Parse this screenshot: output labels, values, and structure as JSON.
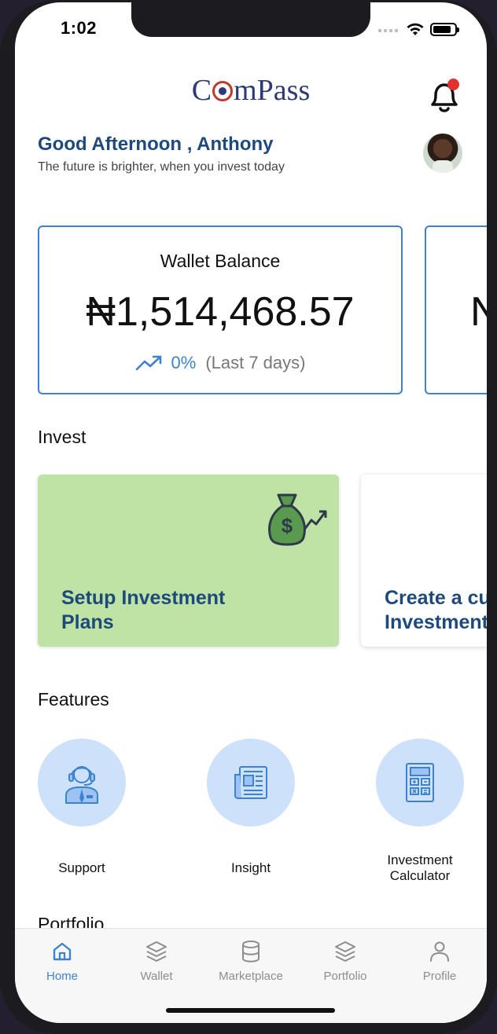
{
  "status_bar": {
    "time": "1:02"
  },
  "header": {
    "logo_text_left": "C",
    "logo_text_right": "mPass"
  },
  "greeting": {
    "title": "Good Afternoon , Anthony",
    "subtitle": "The future is brighter, when you invest today"
  },
  "wallet_card": {
    "title": "Wallet Balance",
    "amount": "₦1,514,468.57",
    "change_percent": "0%",
    "change_period": "(Last 7 days)"
  },
  "second_card": {
    "amount_peek": "N"
  },
  "invest": {
    "section_label": "Invest",
    "cards": [
      {
        "title": "Setup Investment Plans",
        "color": "#bfe2a5"
      },
      {
        "title": "Create a custom Investment",
        "color": "#ffffff"
      }
    ]
  },
  "features": {
    "section_label": "Features",
    "items": [
      {
        "label": "Support",
        "icon": "support-agent-icon"
      },
      {
        "label": "Insight",
        "icon": "newspaper-icon"
      },
      {
        "label": "Investment Calculator",
        "icon": "calculator-icon"
      }
    ]
  },
  "portfolio": {
    "section_label": "Portfolio"
  },
  "tabbar": {
    "tabs": [
      {
        "label": "Home",
        "icon": "home-icon",
        "active": true
      },
      {
        "label": "Wallet",
        "icon": "layers-icon",
        "active": false
      },
      {
        "label": "Marketplace",
        "icon": "database-icon",
        "active": false
      },
      {
        "label": "Portfolio",
        "icon": "layers-icon",
        "active": false
      },
      {
        "label": "Profile",
        "icon": "user-icon",
        "active": false
      }
    ]
  },
  "colors": {
    "accent": "#3d82cf",
    "heading": "#1e4a7b",
    "feature_circle": "#cde1fb",
    "invest_green": "#bfe2a5",
    "notification_dot": "#e0332f"
  }
}
